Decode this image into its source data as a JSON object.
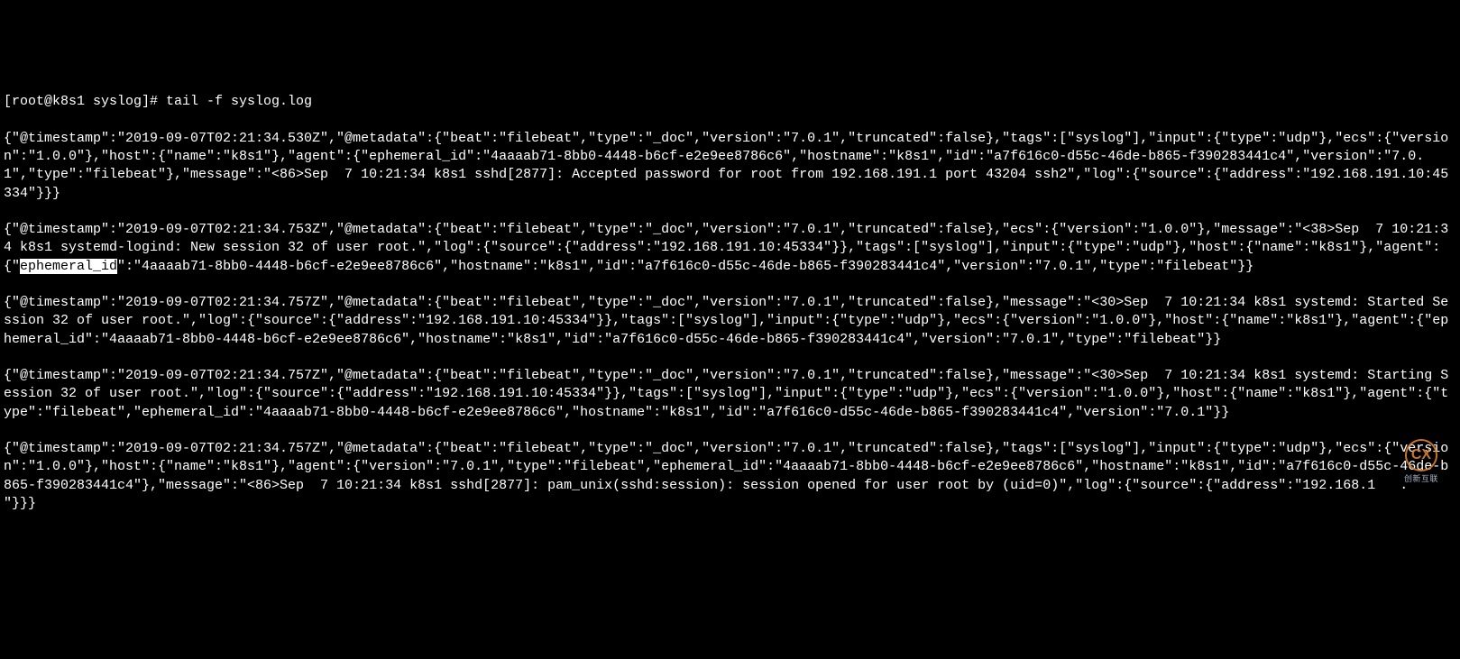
{
  "prompt": "[root@k8s1 syslog]# tail -f syslog.log",
  "highlighted_text": "ephemeral_id",
  "lines": [
    "{\"@timestamp\":\"2019-09-07T02:21:34.530Z\",\"@metadata\":{\"beat\":\"filebeat\",\"type\":\"_doc\",\"version\":\"7.0.1\",\"truncated\":false},\"tags\":[\"syslog\"],\"input\":{\"type\":\"udp\"},\"ecs\":{\"version\":\"1.0.0\"},\"host\":{\"name\":\"k8s1\"},\"agent\":{\"ephemeral_id\":\"4aaaab71-8bb0-4448-b6cf-e2e9ee8786c6\",\"hostname\":\"k8s1\",\"id\":\"a7f616c0-d55c-46de-b865-f390283441c4\",\"version\":\"7.0.1\",\"type\":\"filebeat\"},\"message\":\"<86>Sep  7 10:21:34 k8s1 sshd[2877]: Accepted password for root from 192.168.191.1 port 43204 ssh2\",\"log\":{\"source\":{\"address\":\"192.168.191.10:45334\"}}}",
    "{\"@timestamp\":\"2019-09-07T02:21:34.753Z\",\"@metadata\":{\"beat\":\"filebeat\",\"type\":\"_doc\",\"version\":\"7.0.1\",\"truncated\":false},\"ecs\":{\"version\":\"1.0.0\"},\"message\":\"<38>Sep  7 10:21:34 k8s1 systemd-logind: New session 32 of user root.\",\"log\":{\"source\":{\"address\":\"192.168.191.10:45334\"}},\"tags\":[\"syslog\"],\"input\":{\"type\":\"udp\"},\"host\":{\"name\":\"k8s1\"},\"agent\":{\"",
    "\":\"4aaaab71-8bb0-4448-b6cf-e2e9ee8786c6\",\"hostname\":\"k8s1\",\"id\":\"a7f616c0-d55c-46de-b865-f390283441c4\",\"version\":\"7.0.1\",\"type\":\"filebeat\"}}",
    "{\"@timestamp\":\"2019-09-07T02:21:34.757Z\",\"@metadata\":{\"beat\":\"filebeat\",\"type\":\"_doc\",\"version\":\"7.0.1\",\"truncated\":false},\"message\":\"<30>Sep  7 10:21:34 k8s1 systemd: Started Session 32 of user root.\",\"log\":{\"source\":{\"address\":\"192.168.191.10:45334\"}},\"tags\":[\"syslog\"],\"input\":{\"type\":\"udp\"},\"ecs\":{\"version\":\"1.0.0\"},\"host\":{\"name\":\"k8s1\"},\"agent\":{\"ephemeral_id\":\"4aaaab71-8bb0-4448-b6cf-e2e9ee8786c6\",\"hostname\":\"k8s1\",\"id\":\"a7f616c0-d55c-46de-b865-f390283441c4\",\"version\":\"7.0.1\",\"type\":\"filebeat\"}}",
    "{\"@timestamp\":\"2019-09-07T02:21:34.757Z\",\"@metadata\":{\"beat\":\"filebeat\",\"type\":\"_doc\",\"version\":\"7.0.1\",\"truncated\":false},\"message\":\"<30>Sep  7 10:21:34 k8s1 systemd: Starting Session 32 of user root.\",\"log\":{\"source\":{\"address\":\"192.168.191.10:45334\"}},\"tags\":[\"syslog\"],\"input\":{\"type\":\"udp\"},\"ecs\":{\"version\":\"1.0.0\"},\"host\":{\"name\":\"k8s1\"},\"agent\":{\"type\":\"filebeat\",\"ephemeral_id\":\"4aaaab71-8bb0-4448-b6cf-e2e9ee8786c6\",\"hostname\":\"k8s1\",\"id\":\"a7f616c0-d55c-46de-b865-f390283441c4\",\"version\":\"7.0.1\"}}",
    "{\"@timestamp\":\"2019-09-07T02:21:34.757Z\",\"@metadata\":{\"beat\":\"filebeat\",\"type\":\"_doc\",\"version\":\"7.0.1\",\"truncated\":false},\"tags\":[\"syslog\"],\"input\":{\"type\":\"udp\"},\"ecs\":{\"version\":\"1.0.0\"},\"host\":{\"name\":\"k8s1\"},\"agent\":{\"version\":\"7.0.1\",\"type\":\"filebeat\",\"ephemeral_id\":\"4aaaab71-8bb0-4448-b6cf-e2e9ee8786c6\",\"hostname\":\"k8s1\",\"id\":\"a7f616c0-d55c-46de-b865-f390283441c4\"},\"message\":\"<86>Sep  7 10:21:34 k8s1 sshd[2877]: pam_unix(sshd:session): session opened for user root by (uid=0)\",\"log\":{\"source\":{\"address\":\"192.168.1   .  \"}}}"
  ],
  "watermark": {
    "initials": "CX",
    "label": "创新互联"
  }
}
